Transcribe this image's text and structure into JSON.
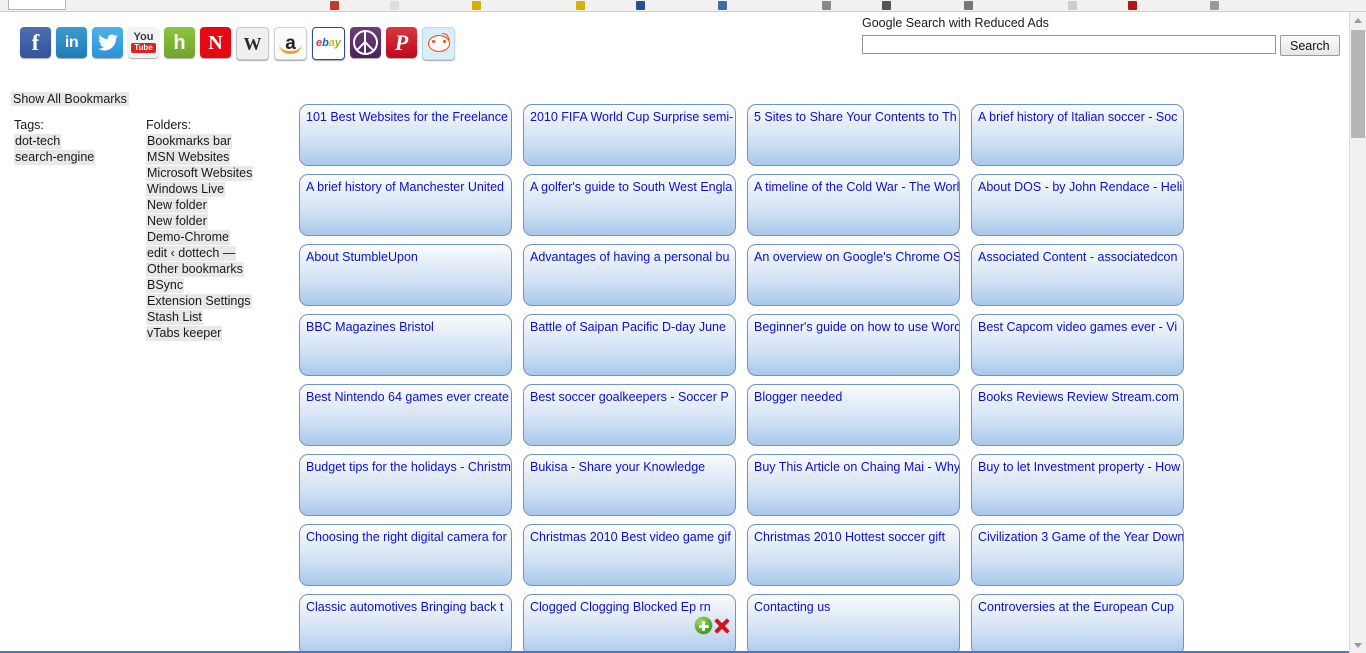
{
  "chrome": {
    "tab_label": "",
    "bookmark_dot_colors": [
      "#c0392b",
      "#dddddd",
      "#d4b106",
      "#d4b106",
      "#2a4d9b",
      "#3a6ea5",
      "#888888",
      "#555555",
      "#777777",
      "#cccccc",
      "#b01818",
      "#999999"
    ]
  },
  "social_bar": {
    "icons": [
      {
        "name": "facebook-icon",
        "label": "f"
      },
      {
        "name": "linkedin-icon",
        "label": "in"
      },
      {
        "name": "twitter-icon",
        "label": "✈"
      },
      {
        "name": "youtube-icon",
        "label_top": "You",
        "label_bottom": "Tube"
      },
      {
        "name": "hubpages-icon",
        "label": "h"
      },
      {
        "name": "netflix-icon",
        "label": "N"
      },
      {
        "name": "wikipedia-icon",
        "label": "W"
      },
      {
        "name": "amazon-icon",
        "label": "a"
      },
      {
        "name": "ebay-icon",
        "e1": "e",
        "e2": "b",
        "e3": "a",
        "e4": "y"
      },
      {
        "name": "peace-icon",
        "label": ""
      },
      {
        "name": "pinterest-icon",
        "label": "P"
      },
      {
        "name": "reddit-icon",
        "label": ""
      }
    ]
  },
  "search": {
    "label": "Google Search with Reduced Ads",
    "value": "",
    "placeholder": "",
    "button_label": "Search"
  },
  "sidebar": {
    "show_all_label": "Show All Bookmarks",
    "tags_heading": "Tags:",
    "tags": [
      "dot-tech",
      "search-engine"
    ],
    "folders_heading": "Folders:",
    "folders": [
      "Bookmarks bar",
      "MSN Websites",
      "Microsoft Websites",
      "Windows Live",
      "New folder",
      "New folder",
      "Demo-Chrome",
      "edit ‹ dottech —",
      "Other bookmarks",
      "BSync",
      "Extension Settings",
      "Stash List",
      "vTabs keeper"
    ]
  },
  "card_actions": {
    "add_label": "add-bookmark",
    "delete_label": "delete-bookmark"
  },
  "grid": {
    "rows": [
      [
        "101 Best Websites for the Freelance",
        "2010 FIFA World Cup Surprise semi-",
        "5 Sites to Share Your Contents to Th",
        "A brief history of Italian soccer - Soc"
      ],
      [
        "A brief history of Manchester United",
        "A golfer's guide to South West Engla",
        "A timeline of the Cold War - The Worl",
        "About DOS - by John Rendace - Heli"
      ],
      [
        "About StumbleUpon",
        "Advantages of having a personal bu",
        "An overview on Google's Chrome OS",
        "Associated Content - associatedcon"
      ],
      [
        "BBC Magazines Bristol",
        "Battle of Saipan Pacific D-day June",
        "Beginner's guide on how to use Word",
        "Best Capcom video games ever - Vi"
      ],
      [
        "Best Nintendo 64 games ever create",
        "Best soccer goalkeepers - Soccer P",
        "Blogger needed",
        "Books Reviews Review Stream.com"
      ],
      [
        "Budget tips for the holidays - Christm",
        "Bukisa - Share your Knowledge",
        "Buy This Article on Chaing Mai - Why",
        "Buy to let Investment property - How"
      ],
      [
        "Choosing the right digital camera for",
        "Christmas 2010 Best video game gif",
        "Christmas 2010 Hottest soccer gift",
        "Civilization 3 Game of the Year Down"
      ],
      [
        "Classic automotives Bringing back t",
        "Clogged Clogging Blocked Ep   rn",
        "Contacting us",
        "Controversies at the European Cup"
      ]
    ]
  },
  "scrollbar": {
    "up_label": "scroll-up",
    "down_label": "scroll-down"
  }
}
